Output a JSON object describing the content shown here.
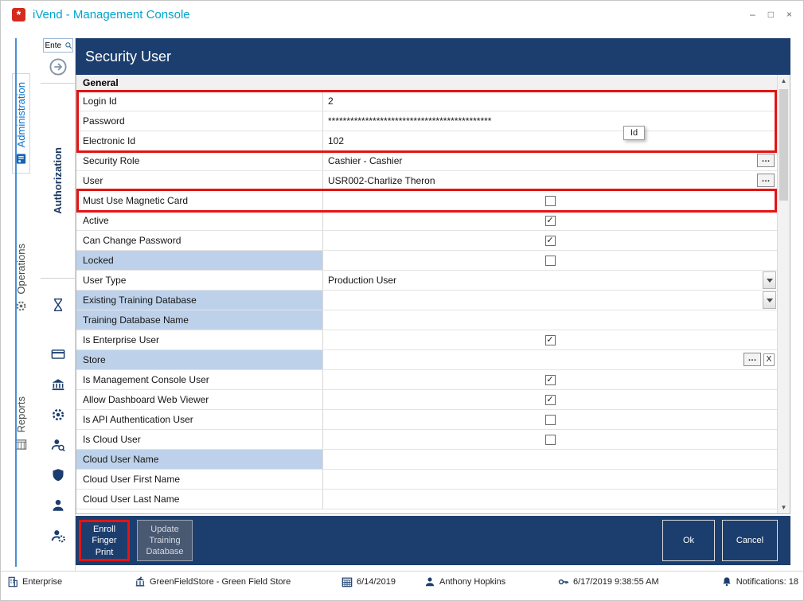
{
  "window": {
    "title": "iVend - Management Console",
    "controls": [
      "–",
      "□",
      "×"
    ]
  },
  "side_tabs": [
    {
      "label": "Administration",
      "active": true
    },
    {
      "label": "Operations",
      "active": false
    },
    {
      "label": "Reports",
      "active": false
    }
  ],
  "toolbar": {
    "search_value": "Ente",
    "panel_label": "Authorization"
  },
  "header": {
    "title": "Security User"
  },
  "form": {
    "section": "General",
    "controls": {
      "check": "✓",
      "ellipsis": "…",
      "clear": "X"
    },
    "rows": [
      {
        "label": "Login Id",
        "type": "text",
        "value": "2"
      },
      {
        "label": "Password",
        "type": "text",
        "value": "********************************************"
      },
      {
        "label": "Electronic Id",
        "type": "text",
        "value": "102"
      },
      {
        "label": "Security Role",
        "type": "lookup",
        "value": "Cashier - Cashier"
      },
      {
        "label": "User",
        "type": "lookup",
        "value": "USR002-Charlize Theron"
      },
      {
        "label": "Must Use Magnetic Card",
        "type": "checkbox",
        "checked": false
      },
      {
        "label": "Active",
        "type": "checkbox",
        "checked": true
      },
      {
        "label": "Can Change Password",
        "type": "checkbox",
        "checked": true
      },
      {
        "label": "Locked",
        "type": "checkbox",
        "checked": false,
        "hl": true
      },
      {
        "label": "User Type",
        "type": "dropdown",
        "value": "Production User"
      },
      {
        "label": "Existing Training Database",
        "type": "dropdown",
        "value": "",
        "hl": true
      },
      {
        "label": "Training Database Name",
        "type": "text",
        "value": "",
        "hl": true
      },
      {
        "label": "Is Enterprise User",
        "type": "checkbox",
        "checked": true
      },
      {
        "label": "Store",
        "type": "lookup-clear",
        "value": "",
        "hl": true
      },
      {
        "label": "Is Management Console User",
        "type": "checkbox",
        "checked": true
      },
      {
        "label": "Allow Dashboard Web Viewer",
        "type": "checkbox",
        "checked": true
      },
      {
        "label": "Is API Authentication User",
        "type": "checkbox",
        "checked": false
      },
      {
        "label": "Is Cloud User",
        "type": "checkbox",
        "checked": false
      },
      {
        "label": "Cloud User Name",
        "type": "text",
        "value": "",
        "hl": true
      },
      {
        "label": "Cloud User First Name",
        "type": "text",
        "value": ""
      },
      {
        "label": "Cloud User Last Name",
        "type": "text",
        "value": ""
      }
    ]
  },
  "tooltip": {
    "text": "Id"
  },
  "scrollbar": {
    "up": "▲",
    "down": "▼"
  },
  "actions": {
    "enroll": "Enroll\nFinger\nPrint",
    "update": "Update\nTraining\nDatabase",
    "ok": "Ok",
    "cancel": "Cancel"
  },
  "statusbar": {
    "items": [
      {
        "icon": "enterprise",
        "text": "Enterprise"
      },
      {
        "icon": "store",
        "text": "GreenFieldStore - Green Field Store"
      },
      {
        "icon": "calendar",
        "text": "6/14/2019"
      },
      {
        "icon": "user",
        "text": "Anthony Hopkins"
      },
      {
        "icon": "key",
        "text": "6/17/2019 9:38:55 AM"
      },
      {
        "icon": "bell",
        "text": "Notifications: 18"
      }
    ]
  },
  "colors": {
    "header_navy": "#1c3e6e",
    "highlight_red": "#e21414",
    "label_blue": "#bdd2ea",
    "title_teal": "#00a5cc",
    "accent_blue": "#4a8fd3"
  }
}
